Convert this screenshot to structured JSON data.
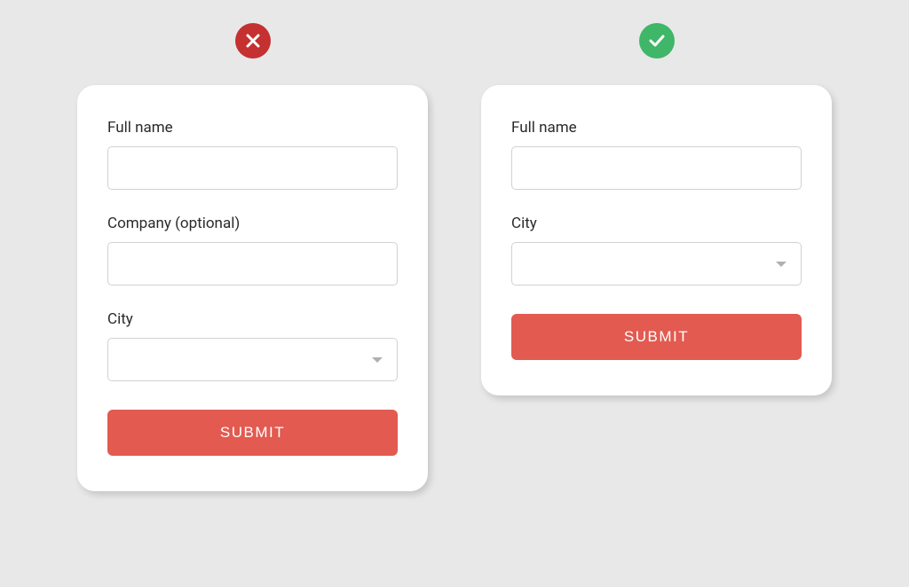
{
  "left": {
    "fields": {
      "fullname_label": "Full name",
      "company_label": "Company (optional)",
      "city_label": "City"
    },
    "submit_label": "SUBMIT"
  },
  "right": {
    "fields": {
      "fullname_label": "Full name",
      "city_label": "City"
    },
    "submit_label": "SUBMIT"
  }
}
